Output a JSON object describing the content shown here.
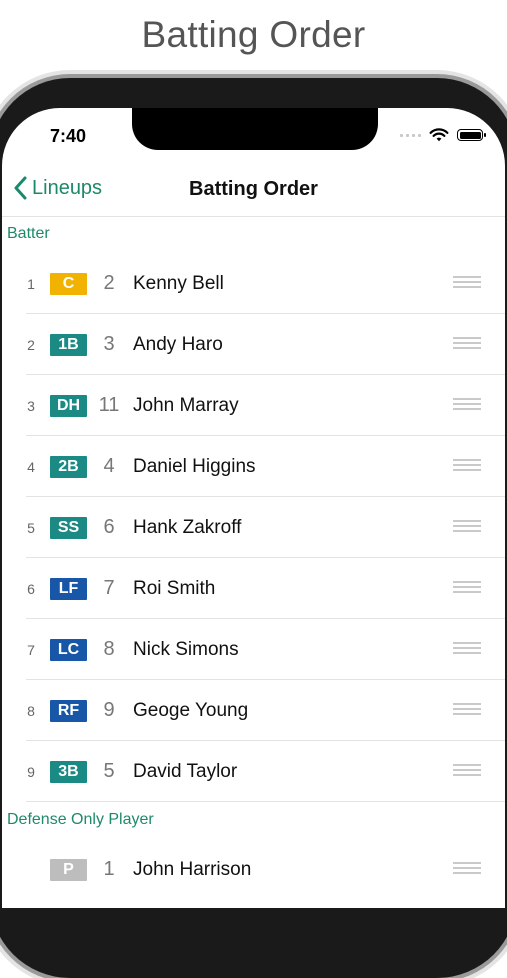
{
  "headline": "Batting Order",
  "status_bar": {
    "time": "7:40"
  },
  "navbar": {
    "back_label": "Lineups",
    "title": "Batting Order"
  },
  "colors": {
    "accent": "#1a8a6a",
    "C": "#f2b202",
    "1B": "#1b8a84",
    "DH": "#1b8a84",
    "2B": "#1b8a84",
    "SS": "#1b8a84",
    "3B": "#1b8a84",
    "LF": "#1856a8",
    "LC": "#1856a8",
    "RF": "#1856a8",
    "P": "#bdbdbd"
  },
  "sections": [
    {
      "header": "Batter",
      "rows": [
        {
          "order": "1",
          "position": "C",
          "number": "2",
          "name": "Kenny Bell"
        },
        {
          "order": "2",
          "position": "1B",
          "number": "3",
          "name": "Andy Haro"
        },
        {
          "order": "3",
          "position": "DH",
          "number": "11",
          "name": "John Marray"
        },
        {
          "order": "4",
          "position": "2B",
          "number": "4",
          "name": "Daniel Higgins"
        },
        {
          "order": "5",
          "position": "SS",
          "number": "6",
          "name": "Hank Zakroff"
        },
        {
          "order": "6",
          "position": "LF",
          "number": "7",
          "name": "Roi Smith"
        },
        {
          "order": "7",
          "position": "LC",
          "number": "8",
          "name": "Nick Simons"
        },
        {
          "order": "8",
          "position": "RF",
          "number": "9",
          "name": "Geoge Young"
        },
        {
          "order": "9",
          "position": "3B",
          "number": "5",
          "name": "David Taylor"
        }
      ]
    },
    {
      "header": "Defense Only Player",
      "rows": [
        {
          "order": "",
          "position": "P",
          "number": "1",
          "name": "John Harrison"
        }
      ]
    }
  ]
}
